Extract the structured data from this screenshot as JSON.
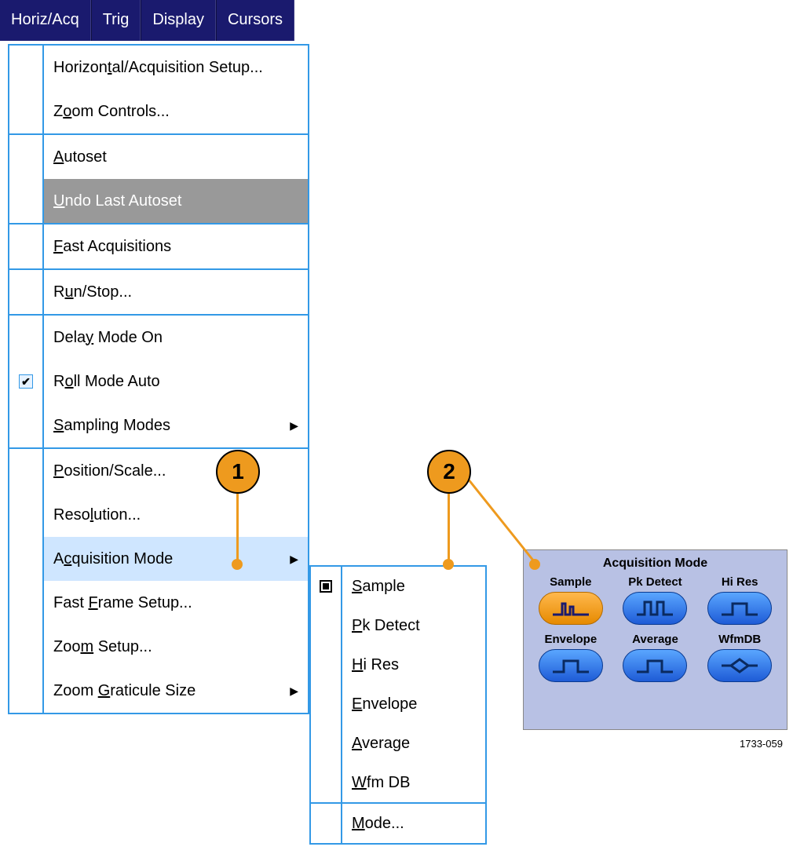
{
  "menubar": {
    "items": [
      "Horiz/Acq",
      "Trig",
      "Display",
      "Cursors"
    ]
  },
  "dropdown": {
    "groups": [
      {
        "items": [
          {
            "label": "Horizontal/Acquisition Setup...",
            "mn": "t"
          },
          {
            "label": "Zoom Controls...",
            "mn": "o"
          }
        ]
      },
      {
        "items": [
          {
            "label": "Autoset",
            "mn": "A"
          },
          {
            "label": "Undo Last Autoset",
            "mn": "U",
            "disabled": true
          }
        ]
      },
      {
        "items": [
          {
            "label": "Fast Acquisitions",
            "mn": "F"
          }
        ]
      },
      {
        "items": [
          {
            "label": "Run/Stop...",
            "mn": "u"
          }
        ]
      },
      {
        "items": [
          {
            "label": "Delay Mode On",
            "mn": "y"
          },
          {
            "label": "Roll Mode Auto",
            "mn": "o",
            "checked": true
          },
          {
            "label": "Sampling Modes",
            "mn": "S",
            "submenu": true
          }
        ]
      },
      {
        "items": [
          {
            "label": "Position/Scale...",
            "mn": "P"
          },
          {
            "label": "Resolution...",
            "mn": "l"
          },
          {
            "label": "Acquisition Mode",
            "mn": "c",
            "submenu": true,
            "highlight": true
          },
          {
            "label": "Fast Frame Setup...",
            "mn": "F"
          },
          {
            "label": "Zoom Setup...",
            "mn": "m"
          },
          {
            "label": "Zoom Graticule Size",
            "mn": "G",
            "submenu": true
          }
        ]
      }
    ]
  },
  "submenu": {
    "selected": "Sample",
    "groups": [
      {
        "items": [
          {
            "label": "Sample",
            "mn": "S",
            "checked": true
          },
          {
            "label": "Pk Detect",
            "mn": "P"
          },
          {
            "label": "Hi Res",
            "mn": "H"
          },
          {
            "label": "Envelope",
            "mn": "E"
          },
          {
            "label": "Average",
            "mn": "A"
          },
          {
            "label": "Wfm DB",
            "mn": "W"
          }
        ]
      },
      {
        "items": [
          {
            "label": "Mode...",
            "mn": "M"
          }
        ]
      }
    ]
  },
  "acqPanel": {
    "title": "Acquisition Mode",
    "buttons": [
      {
        "label": "Sample",
        "selected": true,
        "icon": "sample"
      },
      {
        "label": "Pk Detect",
        "icon": "pkdetect"
      },
      {
        "label": "Hi Res",
        "icon": "hires"
      },
      {
        "label": "Envelope",
        "icon": "envelope"
      },
      {
        "label": "Average",
        "icon": "average"
      },
      {
        "label": "WfmDB",
        "icon": "wfmdb"
      }
    ]
  },
  "callouts": {
    "c1": "1",
    "c2": "2"
  },
  "figref": "1733-059"
}
